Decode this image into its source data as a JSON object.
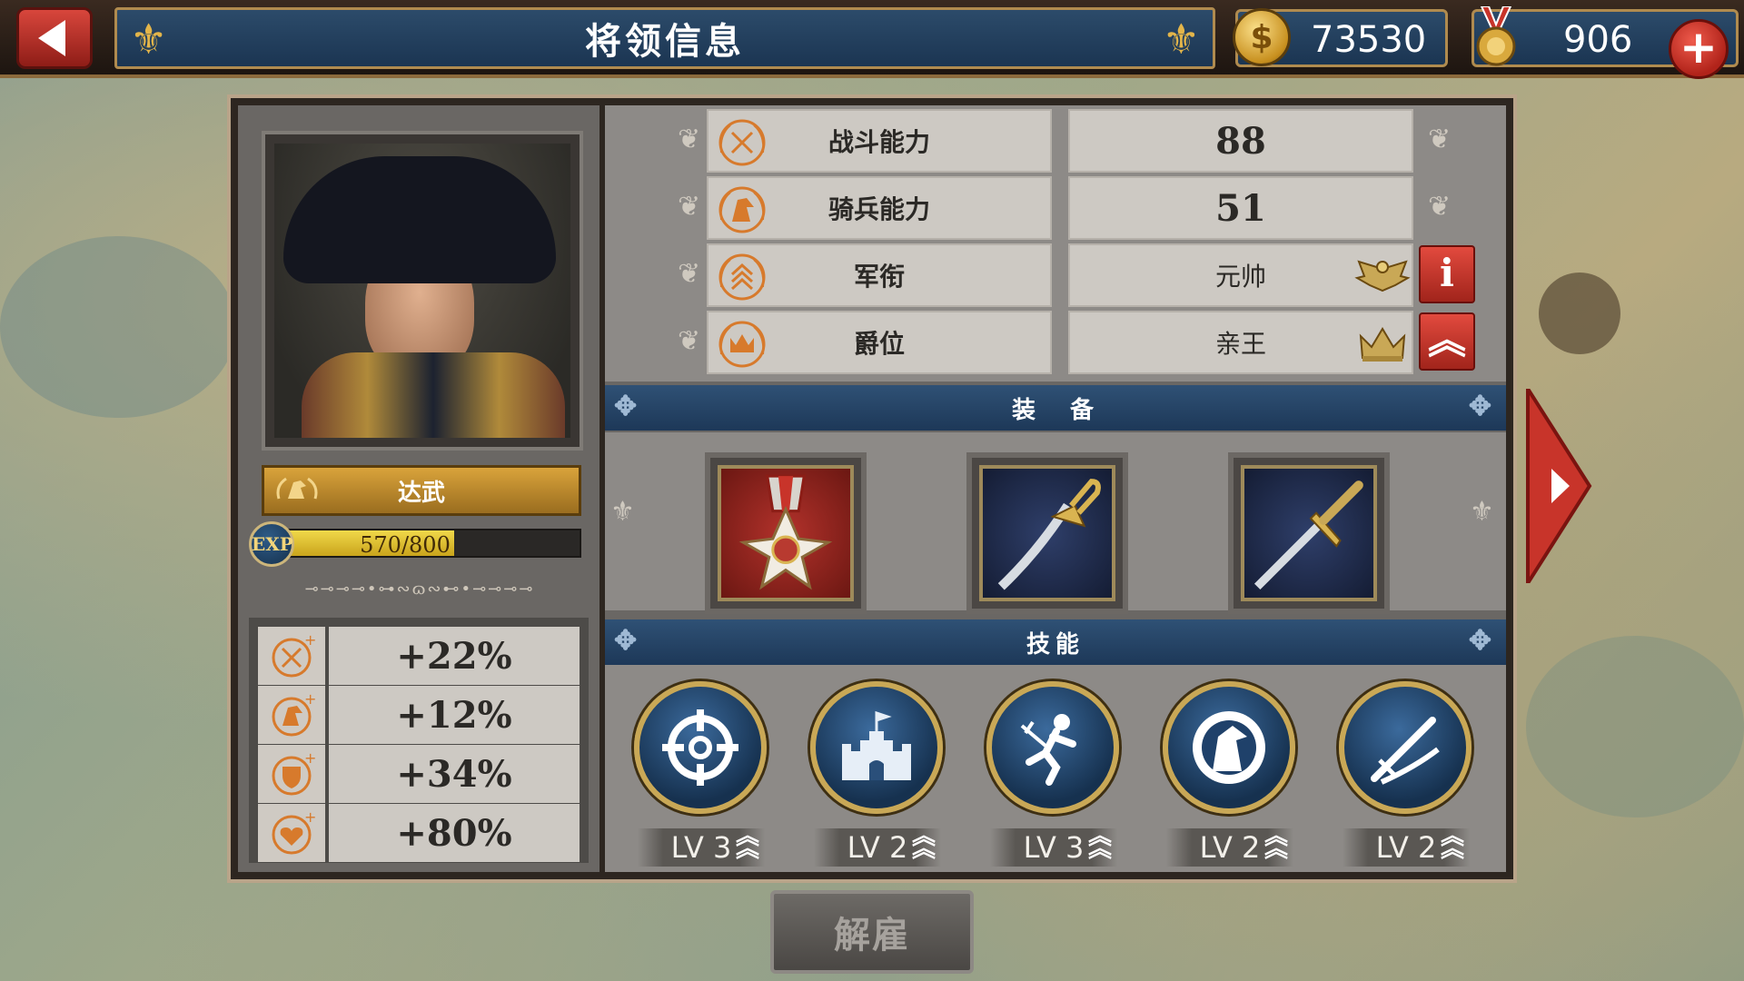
{
  "header": {
    "title": "将领信息",
    "gold": "73530",
    "medals": "906"
  },
  "general": {
    "rank_title": "达武",
    "exp_label": "EXP",
    "exp_text": "570/800",
    "exp_progress": 0.7125,
    "bonuses": [
      {
        "icon": "crossed-swords-plus-icon",
        "value": "+22%"
      },
      {
        "icon": "horse-plus-icon",
        "value": "+12%"
      },
      {
        "icon": "shield-plus-icon",
        "value": "+34%"
      },
      {
        "icon": "heart-plus-icon",
        "value": "+80%"
      }
    ]
  },
  "stats": [
    {
      "label": "战斗能力",
      "value": "88",
      "icon": "crossed-swords-icon"
    },
    {
      "label": "骑兵能力",
      "value": "51",
      "icon": "horse-head-icon"
    },
    {
      "label": "军衔",
      "value": "元帅",
      "icon": "chevron-rank-icon",
      "badge": "eagle-wings-icon",
      "action": "info-button",
      "action_label": "i"
    },
    {
      "label": "爵位",
      "value": "亲王",
      "icon": "crown-icon",
      "badge": "crown-badge-icon",
      "action": "upgrade-button",
      "action_label": "︽"
    }
  ],
  "equipment": {
    "title": "装　备",
    "items": [
      "medal-icon",
      "saber-icon",
      "sword-icon"
    ]
  },
  "skills": {
    "title": "技能",
    "items": [
      {
        "icon": "crosshair-icon",
        "level": "LV 3"
      },
      {
        "icon": "fortress-icon",
        "level": "LV 2"
      },
      {
        "icon": "running-soldier-icon",
        "level": "LV 3"
      },
      {
        "icon": "horse-icon",
        "level": "LV 2"
      },
      {
        "icon": "crossed-blades-icon",
        "level": "LV 2"
      }
    ]
  },
  "dismiss_label": "解雇",
  "colors": {
    "accent_red": "#c8342a",
    "header_blue": "#1d3858",
    "gold": "#c9a856"
  }
}
